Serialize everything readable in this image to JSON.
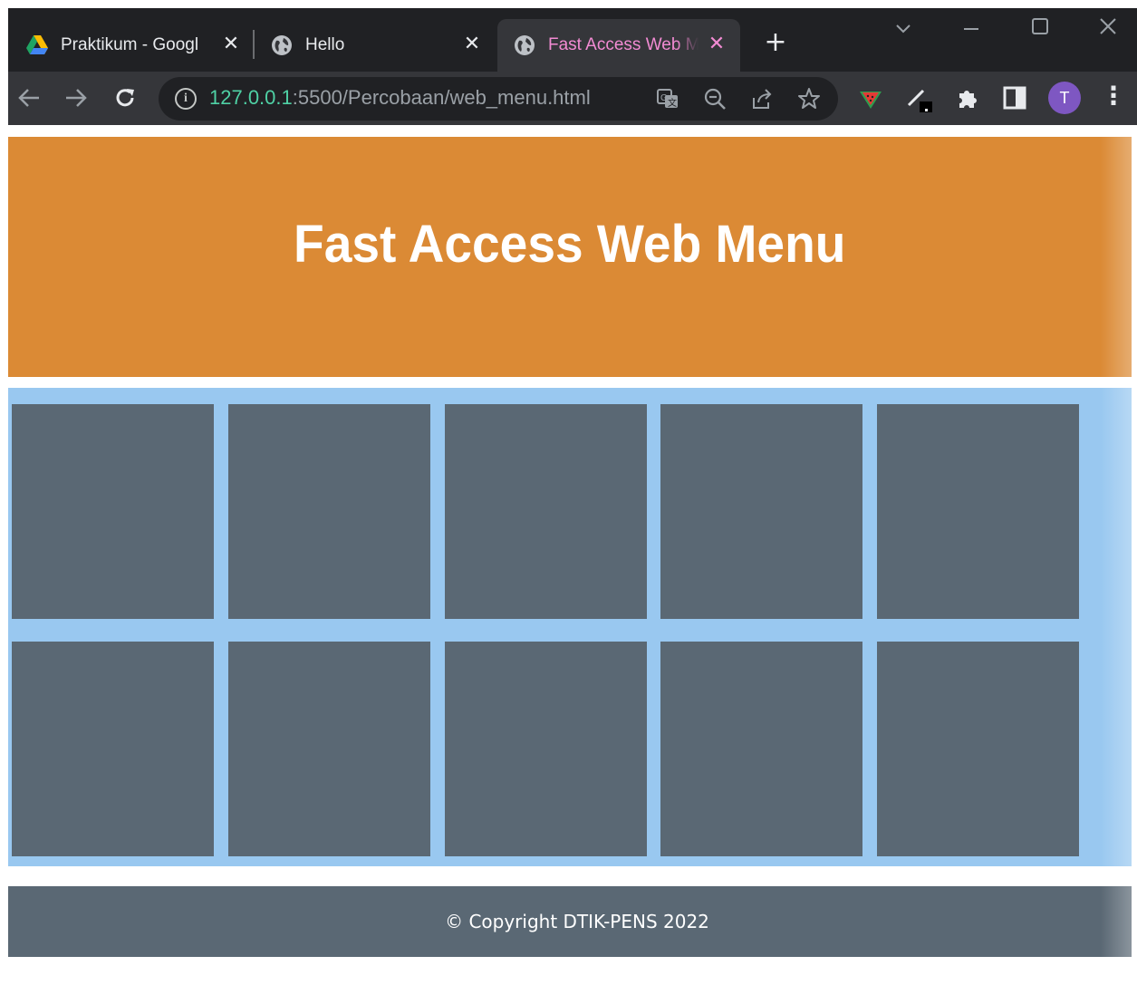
{
  "browser": {
    "tabs": [
      {
        "title": "Praktikum - Googl",
        "icon": "google-drive-icon",
        "active": false
      },
      {
        "title": "Hello",
        "icon": "globe-icon",
        "active": false
      },
      {
        "title": "Fast Access Web M",
        "icon": "globe-icon",
        "active": true
      }
    ],
    "close_glyph": "✕",
    "new_tab_glyph": "+",
    "url_host": "127.0.0.1",
    "url_rest": ":5500/Percobaan/web_menu.html",
    "avatar_letter": "T"
  },
  "page": {
    "title": "Fast Access Web Menu",
    "tiles": [
      "",
      "",
      "",
      "",
      "",
      "",
      "",
      "",
      "",
      ""
    ],
    "footer": "© Copyright DTIK-PENS 2022"
  },
  "colors": {
    "header": "#db8a35",
    "menu_background": "#99c8f0",
    "tile": "#5a6874",
    "footer": "#5a6874",
    "active_tab_text": "#f28bd3",
    "url_host": "#4fd1a5"
  }
}
